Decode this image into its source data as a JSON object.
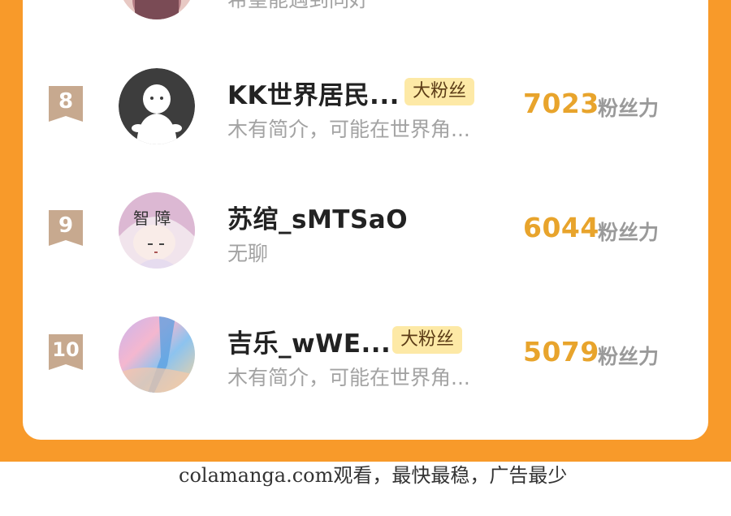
{
  "partial_row": {
    "bio": "希望能遇到同好"
  },
  "rows": [
    {
      "rank": "8",
      "name": "KK世界居民...",
      "badge": "大粉丝",
      "bio": "木有简介，可能在世界角...",
      "score": "7023",
      "fans_label": "粉丝力",
      "avatar": "default-avatar"
    },
    {
      "rank": "9",
      "name": "苏绾_sMTSaO",
      "badge": "",
      "bio": "无聊",
      "score": "6044",
      "fans_label": "粉丝力",
      "avatar": "anime-girl-avatar",
      "avatar_text": "智 障"
    },
    {
      "rank": "10",
      "name": "吉乐_wWE...",
      "badge": "大粉丝",
      "bio": "木有简介，可能在世界角...",
      "score": "5079",
      "fans_label": "粉丝力",
      "avatar": "sky-painting-avatar"
    }
  ],
  "watermark": "colamanga.com观看，最快最稳，广告最少",
  "colors": {
    "frame": "#f89a2a",
    "rank_badge": "#c7a98f",
    "score": "#e8a42c",
    "fan_badge_bg": "#fde9a6"
  }
}
